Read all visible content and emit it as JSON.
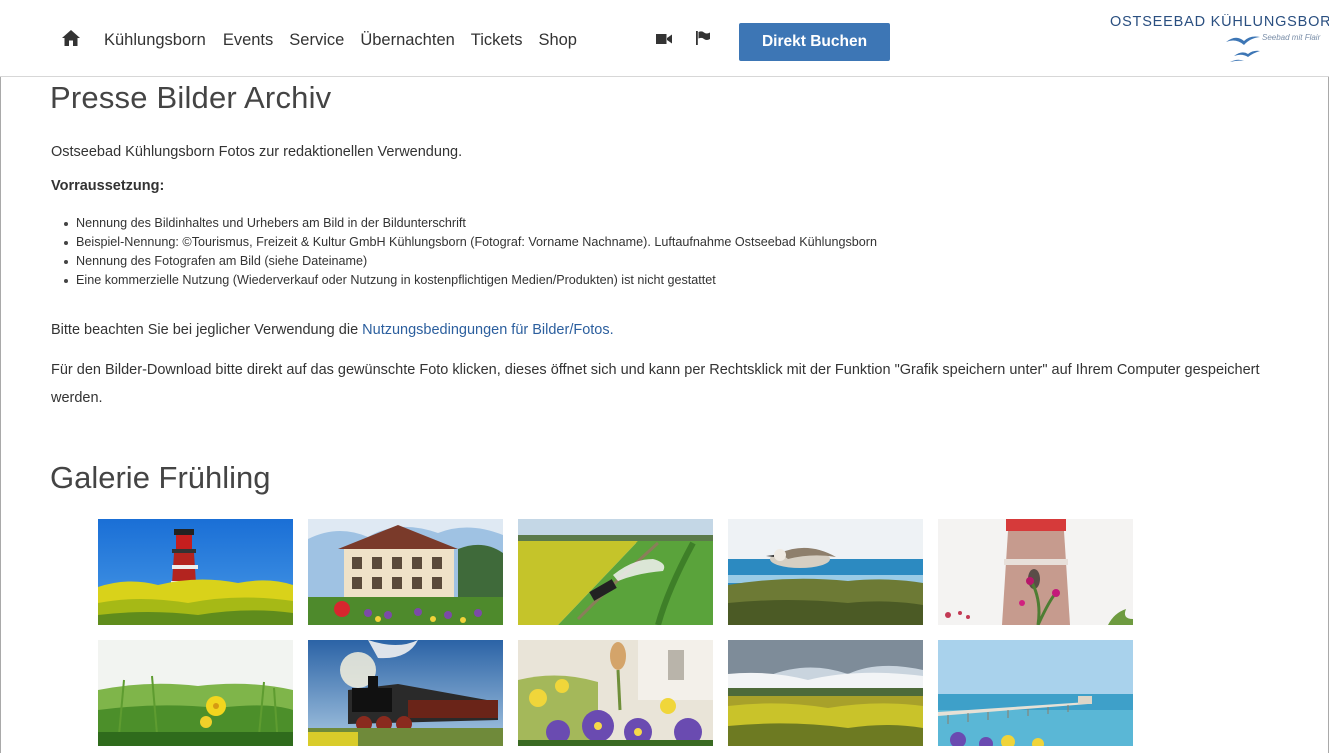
{
  "nav": {
    "items": [
      "Kühlungsborn",
      "Events",
      "Service",
      "Übernachten",
      "Tickets",
      "Shop"
    ],
    "book_label": "Direkt Buchen",
    "icons": [
      "home-icon",
      "video-camera-icon",
      "flag-icon"
    ]
  },
  "logo": {
    "title": "OSTSEEBAD KÜHLUNGSBORN",
    "subtitle": "Seebad mit Flair"
  },
  "main": {
    "title": "Presse Bilder Archiv",
    "intro": "Ostseebad Kühlungsborn Fotos zur redaktionellen Verwendung.",
    "requirements_label": "Vorraussetzung:",
    "requirements": [
      "Nennung des Bildinhaltes und Urhebers am Bild in der Bildunterschrift",
      "Beispiel-Nennung: ©Tourismus, Freizeit & Kultur GmbH Kühlungsborn (Fotograf: Vorname Nachname). Luftaufnahme Ostseebad Kühlungsborn",
      "Nennung des Fotografen am Bild (siehe Dateiname)",
      "Eine kommerzielle Nutzung (Wiederverkauf oder Nutzung in kostenpflichtigen Medien/Produkten) ist nicht gestattet"
    ],
    "note_prefix": "Bitte beachten Sie bei jeglicher Verwendung die ",
    "note_link": "Nutzungsbedingungen für Bilder/Fotos.",
    "download_text": "Für den Bilder-Download bitte direkt auf das gewünschte Foto klicken, dieses öffnet sich und kann per Rechtsklick mit der Funktion \"Grafik speichern unter\" auf Ihrem Computer gespeichert werden."
  },
  "gallery": {
    "title": "Galerie Frühling",
    "photos": [
      "lighthouse-rapeseed-photo",
      "villa-tulips-photo",
      "steam-train-fields-photo",
      "seagull-photo",
      "lighthouse-blur-photo",
      "meadow-flower-photo",
      "steam-locomotive-photo",
      "pansies-photo",
      "rapeseed-clouds-photo",
      "pier-sea-photo"
    ]
  },
  "colors": {
    "accent": "#3d76b5",
    "link": "#2c5f9e",
    "text": "#333333"
  }
}
